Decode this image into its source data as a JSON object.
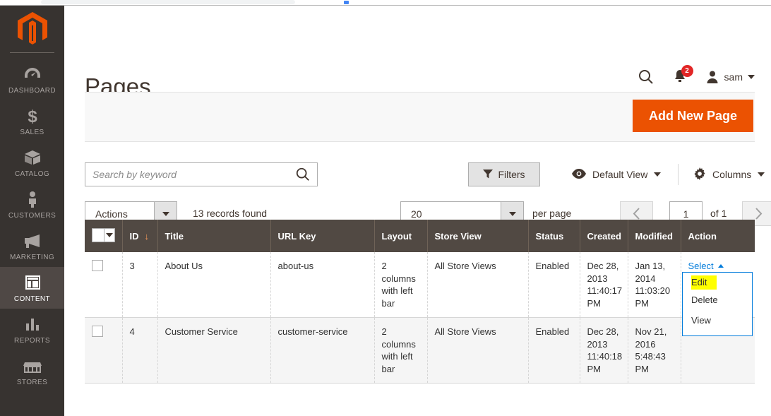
{
  "browser": {
    "omnibox_placeholder": ""
  },
  "sidebar": {
    "logo_name": "magento-logo",
    "items": [
      {
        "label": "DASHBOARD",
        "icon": "dashboard-icon",
        "active": false
      },
      {
        "label": "SALES",
        "icon": "dollar-icon",
        "active": false
      },
      {
        "label": "CATALOG",
        "icon": "box-icon",
        "active": false
      },
      {
        "label": "CUSTOMERS",
        "icon": "person-icon",
        "active": false
      },
      {
        "label": "MARKETING",
        "icon": "megaphone-icon",
        "active": false
      },
      {
        "label": "CONTENT",
        "icon": "layout-icon",
        "active": true
      },
      {
        "label": "REPORTS",
        "icon": "bar-chart-icon",
        "active": false
      },
      {
        "label": "STORES",
        "icon": "store-icon",
        "active": false
      }
    ]
  },
  "header": {
    "title": "Pages",
    "search_icon": "search-icon",
    "notifications_icon": "bell-icon",
    "notifications_count": "2",
    "user_icon": "user-avatar-icon",
    "user_name": "sam"
  },
  "action_strip": {
    "add_new_page_label": "Add New Page"
  },
  "toolbar": {
    "search_placeholder": "Search by keyword",
    "search_value": "",
    "search_icon": "search-icon",
    "filters_label": "Filters",
    "filters_icon": "funnel-icon",
    "view_label": "Default View",
    "view_icon": "eye-icon",
    "columns_label": "Columns",
    "columns_icon": "gear-icon",
    "actions_label": "Actions",
    "records_found": "13 records found",
    "per_page_value": "20",
    "per_page_label": "per page",
    "pager_prev_icon": "chevron-left-icon",
    "pager_next_icon": "chevron-right-icon",
    "pager_current": "1",
    "pager_total": "of 1"
  },
  "grid": {
    "sort_indicator": "↓",
    "columns": [
      {
        "key": "check",
        "label": ""
      },
      {
        "key": "id",
        "label": "ID"
      },
      {
        "key": "title",
        "label": "Title"
      },
      {
        "key": "url_key",
        "label": "URL Key"
      },
      {
        "key": "layout",
        "label": "Layout"
      },
      {
        "key": "store_view",
        "label": "Store View"
      },
      {
        "key": "status",
        "label": "Status"
      },
      {
        "key": "created",
        "label": "Created"
      },
      {
        "key": "modified",
        "label": "Modified"
      },
      {
        "key": "action",
        "label": "Action"
      }
    ],
    "rows": [
      {
        "id": "3",
        "title": "About Us",
        "url_key": "about-us",
        "layout": "2 columns with left bar",
        "store_view": "All Store Views",
        "status": "Enabled",
        "created": "Dec 28, 2013 11:40:17 PM",
        "modified": "Jan 13, 2014 11:03:20 PM",
        "action_label": "Select",
        "action_open": true
      },
      {
        "id": "4",
        "title": "Customer Service",
        "url_key": "customer-service",
        "layout": "2 columns with left bar",
        "store_view": "All Store Views",
        "status": "Enabled",
        "created": "Dec 28, 2013 11:40:18 PM",
        "modified": "Nov 21, 2016 5:48:43 PM",
        "action_label": "",
        "action_open": false
      }
    ]
  },
  "action_dropdown": {
    "items": [
      {
        "label": "Edit",
        "highlighted": true
      },
      {
        "label": "Delete",
        "highlighted": false
      },
      {
        "label": "View",
        "highlighted": false
      }
    ]
  },
  "colors": {
    "brand_orange": "#eb5202",
    "sidebar_bg": "#373330",
    "grid_header_bg": "#514943",
    "link_blue": "#007bdb",
    "badge_red": "#e22626",
    "highlight_yellow": "#ffff00"
  }
}
